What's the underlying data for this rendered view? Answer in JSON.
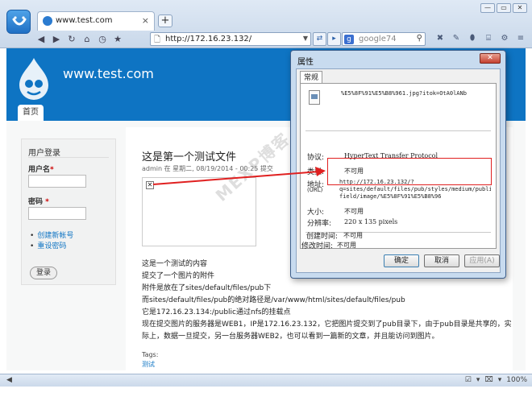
{
  "browser": {
    "tab_title": "www.test.com",
    "tab_close": "×",
    "new_tab": "+",
    "url": "http://172.16.23.132/",
    "search_placeholder": "google74",
    "win_buttons": [
      "—",
      "▭",
      "✕"
    ],
    "nav_icons": [
      "back-icon",
      "forward-icon",
      "refresh-icon",
      "home-icon",
      "history-icon",
      "favorites-icon"
    ]
  },
  "site": {
    "name": "www.test.com",
    "home_tab": "首页",
    "accent": "#0e74c3"
  },
  "login": {
    "title": "用户登录",
    "username_label": "用户名",
    "password_label": "密码",
    "required_mark": "*",
    "create_account": "创建新帐号",
    "reset_password": "重设密码",
    "submit": "登录"
  },
  "node": {
    "title": "这是第一个测试文件",
    "meta": "admin 在 星期二, 08/19/2014 - 00:25 提交",
    "body": [
      "这是一个测试的内容",
      "提交了一个图片的附件",
      "附件是放在了sites/default/files/pub下",
      "而sites/default/files/pub的绝对路径是/var/www/html/sites/default/files/pub",
      "它是172.16.23.134:/public通过nfs的挂载点",
      "现在提交图片的服务器是WEB1，IP是172.16.23.132，它把图片提交到了pub目录下，由于pub目录是共享的，实",
      "际上，数据一旦提交，另一台服务器WEB2，也可以看到一篇新的文章，并且能访问到图片。"
    ],
    "tags_label": "Tags:",
    "tag": "测试"
  },
  "watermark": "MEXP博客",
  "dialog": {
    "title": "属性",
    "close": "✕",
    "tab": "常规",
    "file_name": "%E5%8F%91%E5%B8%961.jpg?itok=OtA0lANb",
    "protocol_label": "协议:",
    "protocol_value": "HyperText Transfer Protocol",
    "type_label": "类型:",
    "type_value": "不可用",
    "address_label": "地址:",
    "address_sublabel": "(URL)",
    "address_lines": [
      "http://172.16.23.132/?",
      "q=sites/default/files/pub/styles/medium/public/",
      "field/image/%E5%8F%91%E5%B8%96"
    ],
    "size_label": "大小:",
    "size_value": "不可用",
    "resolution_label": "分辨率:",
    "resolution_value": "220  x  135  pixels",
    "created_label": "创建时间:",
    "created_value": "不可用",
    "modified_label": "修改时间:",
    "modified_value": "不可用",
    "ok": "确定",
    "cancel": "取消",
    "apply": "应用(A)"
  },
  "status": {
    "left": "◀",
    "zoom": "100%",
    "icons": [
      "☑",
      "▾",
      "⌧",
      "▾"
    ]
  }
}
